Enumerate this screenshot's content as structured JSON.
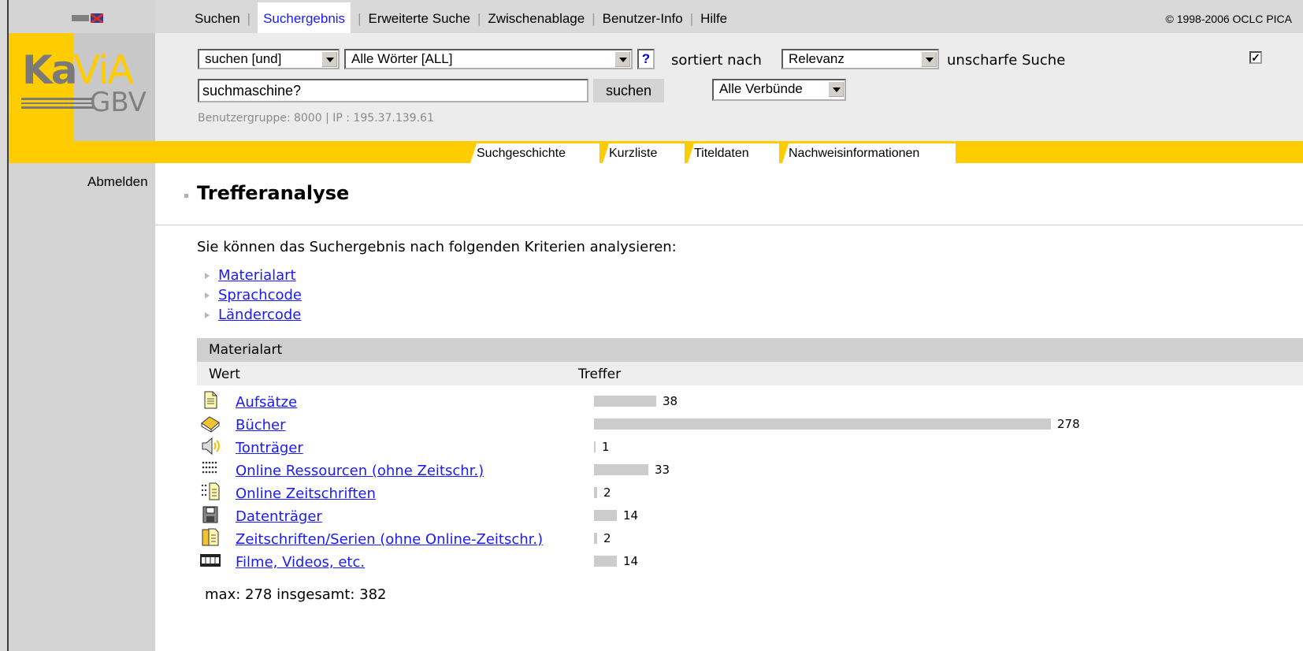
{
  "top_nav": {
    "items": [
      "Suchen",
      "Suchergebnis",
      "Erweiterte Suche",
      "Zwischenablage",
      "Benutzer-Info",
      "Hilfe"
    ],
    "active": "Suchergebnis",
    "copyright": "© 1998-2006 OCLC PICA"
  },
  "logo": {
    "ka": "Ka",
    "via": "ViA",
    "gbv": "GBV"
  },
  "sidebar": {
    "logout": "Abmelden"
  },
  "search": {
    "operator_select": "suchen [und]",
    "field_select": "Alle Wörter [ALL]",
    "help_label": "?",
    "sort_label": "sortiert nach",
    "sort_select": "Relevanz",
    "fuzzy_label": "unscharfe Suche",
    "fuzzy_checked": true,
    "fuzzy_mark": "✓",
    "query": "suchmaschine?",
    "search_button": "suchen",
    "network_select": "Alle Verbünde",
    "user_info": "Benutzergruppe: 8000 | IP : 195.37.139.61"
  },
  "tabs": [
    "Suchgeschichte",
    "Kurzliste",
    "Titeldaten",
    "Nachweisinformationen"
  ],
  "main": {
    "title": "Trefferanalyse",
    "description": "Sie können das Suchergebnis nach folgenden Kriterien analysieren:",
    "criteria": [
      "Materialart",
      "Sprachcode",
      "Ländercode"
    ],
    "table_title": "Materialart",
    "col_value": "Wert",
    "col_hits": "Treffer",
    "rows": [
      {
        "label": "Aufsätze",
        "count": 38,
        "icon": "article-icon"
      },
      {
        "label": "Bücher",
        "count": 278,
        "icon": "book-icon"
      },
      {
        "label": "Tonträger",
        "count": 1,
        "icon": "speaker-icon"
      },
      {
        "label": "Online Ressourcen (ohne Zeitschr.)",
        "count": 33,
        "icon": "online-resource-icon"
      },
      {
        "label": "Online Zeitschriften",
        "count": 2,
        "icon": "online-journal-icon"
      },
      {
        "label": "Datenträger",
        "count": 14,
        "icon": "floppy-disk-icon"
      },
      {
        "label": "Zeitschriften/Serien (ohne Online-Zeitschr.)",
        "count": 2,
        "icon": "journal-icon"
      },
      {
        "label": "Filme, Videos, etc.",
        "count": 14,
        "icon": "film-icon"
      }
    ],
    "max_hits": 278,
    "summary": "max: 278 insgesamt: 382"
  }
}
